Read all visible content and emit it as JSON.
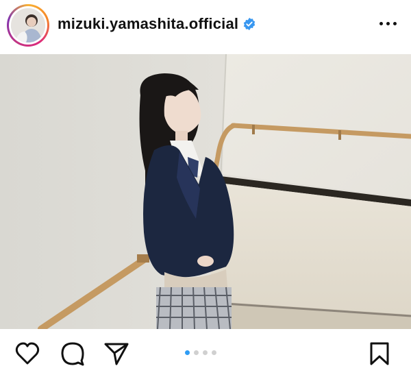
{
  "post": {
    "username": "mizuki.yamashita.official",
    "verified_icon": "verified-badge-icon",
    "more_icon": "more-options-icon",
    "verified_color": "#3897f0"
  },
  "carousel": {
    "count": 4,
    "active_index": 0,
    "active_color": "#2f9cf4",
    "inactive_color": "#d0d0d0"
  },
  "actions": {
    "like_icon": "heart-icon",
    "comment_icon": "comment-icon",
    "share_icon": "paper-plane-icon",
    "save_icon": "bookmark-icon"
  }
}
